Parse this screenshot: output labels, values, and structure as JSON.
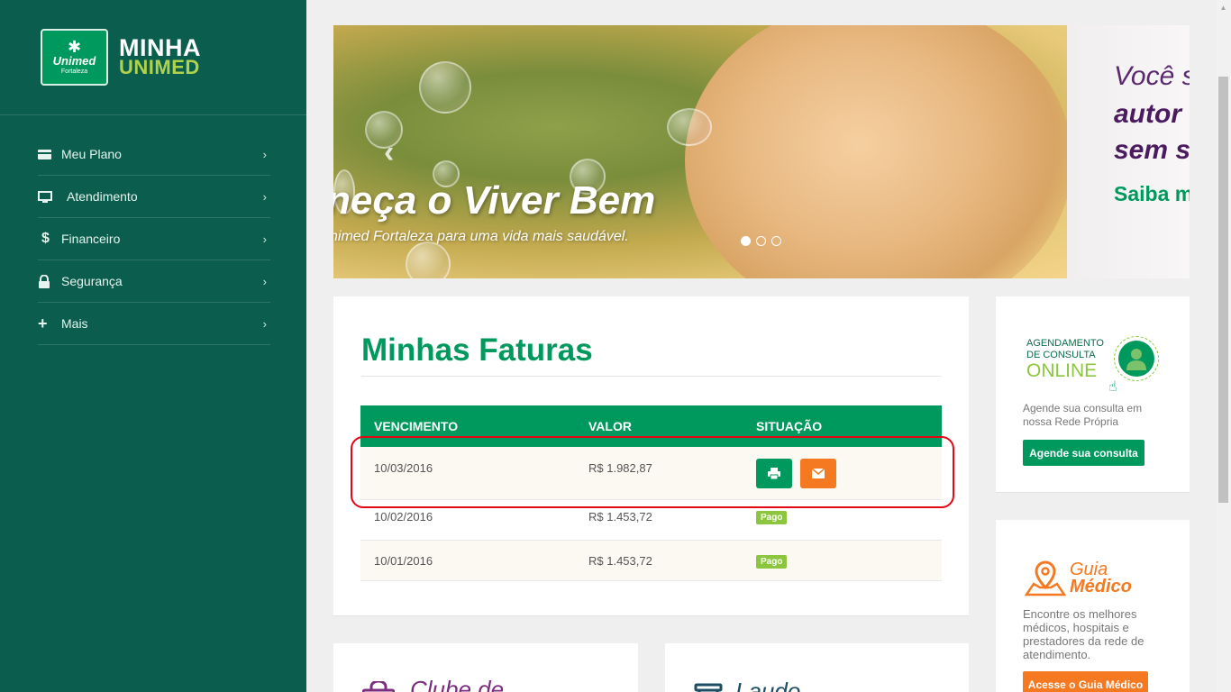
{
  "brand": {
    "logo_glyph": "✱",
    "logo_name": "Unimed",
    "logo_city": "Fortaleza",
    "title_line1": "MINHA",
    "title_line2": "UNIMED"
  },
  "sidebar": {
    "items": [
      {
        "label": "Meu Plano",
        "icon": "credit-card-icon"
      },
      {
        "label": "Atendimento",
        "icon": "monitor-icon"
      },
      {
        "label": "Financeiro",
        "icon": "dollar-icon"
      },
      {
        "label": "Segurança",
        "icon": "lock-icon"
      },
      {
        "label": "Mais",
        "icon": "plus-icon"
      }
    ]
  },
  "banner": {
    "slide1_title": "neça o Viver Bem",
    "slide1_subtitle": "nimed Fortaleza para uma vida mais saudável.",
    "slide2_line1": "Você s",
    "slide2_line2": "autor",
    "slide2_line3": "sem s",
    "slide2_line4": "Saiba m",
    "slide_count": 3,
    "active_slide": 1
  },
  "invoices": {
    "title": "Minhas Faturas",
    "columns": [
      "VENCIMENTO",
      "VALOR",
      "SITUAÇÃO"
    ],
    "rows": [
      {
        "due": "10/03/2016",
        "value": "R$ 1.982,87",
        "status": ""
      },
      {
        "due": "10/02/2016",
        "value": "R$ 1.453,72",
        "status": "Pago"
      },
      {
        "due": "10/01/2016",
        "value": "R$ 1.453,72",
        "status": "Pago"
      }
    ]
  },
  "appointment": {
    "logo_line1": "AGENDAMENTO",
    "logo_line2": "DE CONSULTA",
    "logo_line3": "ONLINE",
    "description": "Agende sua consulta em nossa Rede Própria",
    "button": "Agende sua consulta"
  },
  "guide": {
    "title1": "Guia",
    "title2": "Médico",
    "description": "Encontre os melhores médicos, hospitais e prestadores da rede de atendimento.",
    "button": "Acesse o Guia Médico"
  },
  "club": {
    "title": "Clube de"
  },
  "laudo": {
    "title": "Laudo"
  },
  "colors": {
    "sidebar_bg": "#0b5e4e",
    "brand_green": "#00995d",
    "accent_orange": "#f47920",
    "light_green": "#8cc63f",
    "highlight_red": "#e30613"
  }
}
